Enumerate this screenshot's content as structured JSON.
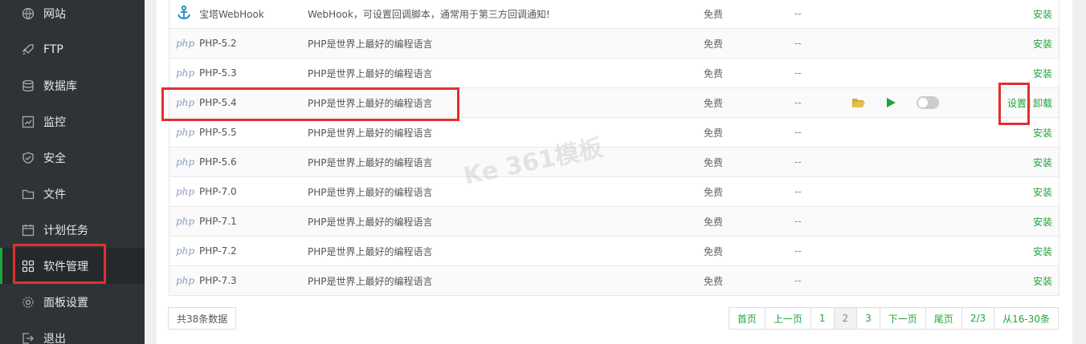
{
  "sidebar": {
    "items": [
      {
        "label": "网站",
        "icon": "globe-icon"
      },
      {
        "label": "FTP",
        "icon": "rocket-icon"
      },
      {
        "label": "数据库",
        "icon": "database-icon"
      },
      {
        "label": "监控",
        "icon": "monitor-icon"
      },
      {
        "label": "安全",
        "icon": "shield-icon"
      },
      {
        "label": "文件",
        "icon": "folder-icon"
      },
      {
        "label": "计划任务",
        "icon": "calendar-icon"
      },
      {
        "label": "软件管理",
        "icon": "grid-icon",
        "active": true
      },
      {
        "label": "面板设置",
        "icon": "gear-icon"
      },
      {
        "label": "退出",
        "icon": "logout-icon"
      }
    ]
  },
  "table": {
    "rows": [
      {
        "logo": "anchor-icon",
        "name": "宝塔WebHook",
        "desc": "WebHook，可设置回调脚本，通常用于第三方回调通知!",
        "price": "免费",
        "expire": "--",
        "action": "安装"
      },
      {
        "logo": "php",
        "name": "PHP-5.2",
        "desc": "PHP是世界上最好的编程语言",
        "price": "免费",
        "expire": "--",
        "action": "安装"
      },
      {
        "logo": "php",
        "name": "PHP-5.3",
        "desc": "PHP是世界上最好的编程语言",
        "price": "免费",
        "expire": "--",
        "action": "安装"
      },
      {
        "logo": "php",
        "name": "PHP-5.4",
        "desc": "PHP是世界上最好的编程语言",
        "price": "免费",
        "expire": "--",
        "action": "设置",
        "action2": "卸载",
        "installed": true
      },
      {
        "logo": "php",
        "name": "PHP-5.5",
        "desc": "PHP是世界上最好的编程语言",
        "price": "免费",
        "expire": "--",
        "action": "安装"
      },
      {
        "logo": "php",
        "name": "PHP-5.6",
        "desc": "PHP是世界上最好的编程语言",
        "price": "免费",
        "expire": "--",
        "action": "安装"
      },
      {
        "logo": "php",
        "name": "PHP-7.0",
        "desc": "PHP是世界上最好的编程语言",
        "price": "免费",
        "expire": "--",
        "action": "安装"
      },
      {
        "logo": "php",
        "name": "PHP-7.1",
        "desc": "PHP是世界上最好的编程语言",
        "price": "免费",
        "expire": "--",
        "action": "安装"
      },
      {
        "logo": "php",
        "name": "PHP-7.2",
        "desc": "PHP是世界上最好的编程语言",
        "price": "免费",
        "expire": "--",
        "action": "安装"
      },
      {
        "logo": "php",
        "name": "PHP-7.3",
        "desc": "PHP是世界上最好的编程语言",
        "price": "免费",
        "expire": "--",
        "action": "安装"
      }
    ]
  },
  "php_logo_text": "php",
  "footer": {
    "total": "共38条数据",
    "pager": [
      "首页",
      "上一页",
      "1",
      "2",
      "3",
      "下一页",
      "尾页",
      "2/3",
      "从16-30条"
    ],
    "current_page": "2"
  },
  "watermark": "Ke 361模板",
  "colors": {
    "accent": "#20a53a",
    "sidebar_bg": "#2f3337",
    "highlight": "#e32f2f"
  }
}
